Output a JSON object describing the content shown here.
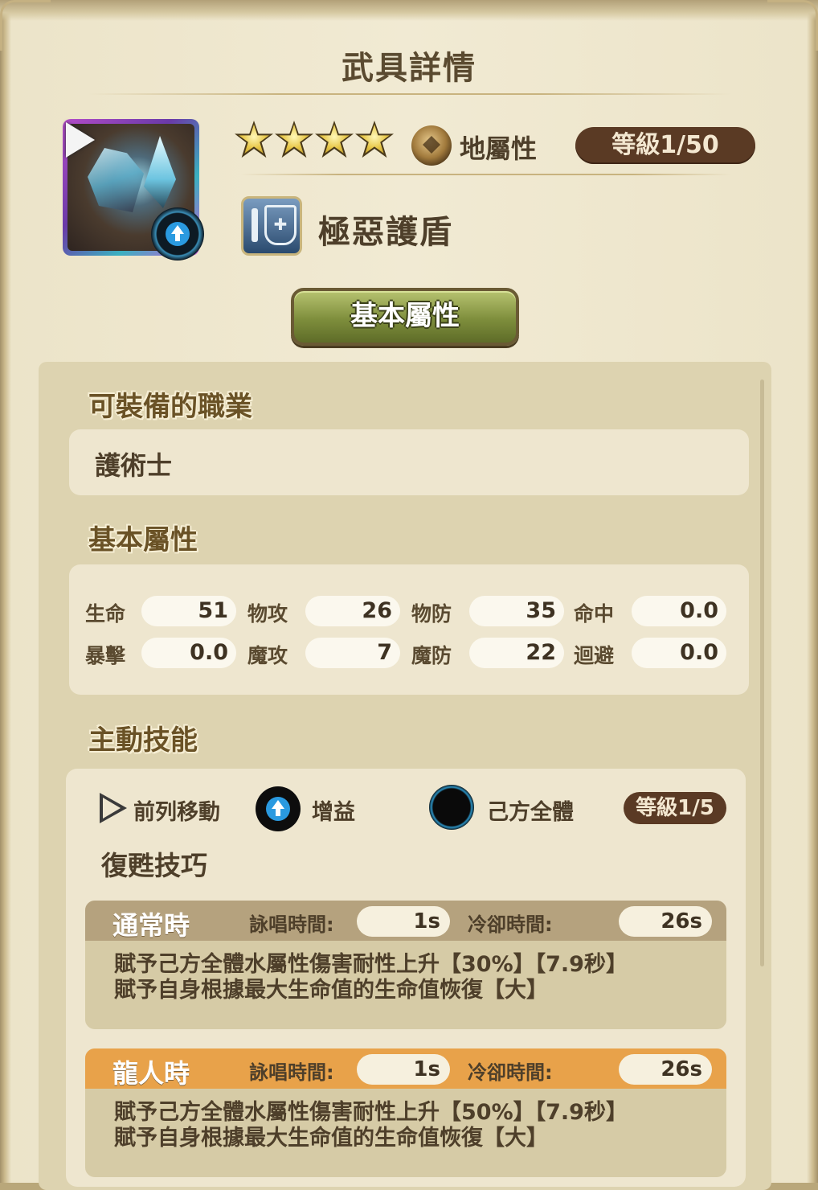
{
  "title": "武具詳情",
  "item": {
    "stars": 4,
    "element": "地屬性",
    "level": "等級1/50",
    "name": "極惡護盾"
  },
  "tab": "基本屬性",
  "sections": {
    "jobs_header": "可裝備的職業",
    "job": "護術士",
    "stats_header": "基本屬性",
    "skill_header": "主動技能"
  },
  "stats": [
    {
      "label": "生命",
      "value": "51"
    },
    {
      "label": "物攻",
      "value": "26"
    },
    {
      "label": "物防",
      "value": "35"
    },
    {
      "label": "命中",
      "value": "0.0"
    },
    {
      "label": "暴擊",
      "value": "0.0"
    },
    {
      "label": "魔攻",
      "value": "7"
    },
    {
      "label": "魔防",
      "value": "22"
    },
    {
      "label": "迴避",
      "value": "0.0"
    }
  ],
  "skill": {
    "move": "前列移動",
    "type": "增益",
    "target": "己方全體",
    "level": "等級1/5",
    "name": "復甦技巧",
    "modes": [
      {
        "title": "通常時",
        "cast_label": "詠唱時間:",
        "cast": "1s",
        "cd_label": "冷卻時間:",
        "cd": "26s",
        "line1": "賦予己方全體水屬性傷害耐性上升【30%】【7.9秒】",
        "line2": "賦予自身根據最大生命值的生命值恢復【大】"
      },
      {
        "title": "龍人時",
        "cast_label": "詠唱時間:",
        "cast": "1s",
        "cd_label": "冷卻時間:",
        "cd": "26s",
        "line1": "賦予己方全體水屬性傷害耐性上升【50%】【7.9秒】",
        "line2": "賦予自身根據最大生命值的生命值恢復【大】"
      }
    ]
  },
  "colors": {
    "parchment": "#f1ead3",
    "panel": "#ddd3b0",
    "pill_brown": "#5a3a24",
    "tab_green": "#7e8e3c",
    "dragon_orange": "#e8a24a"
  }
}
